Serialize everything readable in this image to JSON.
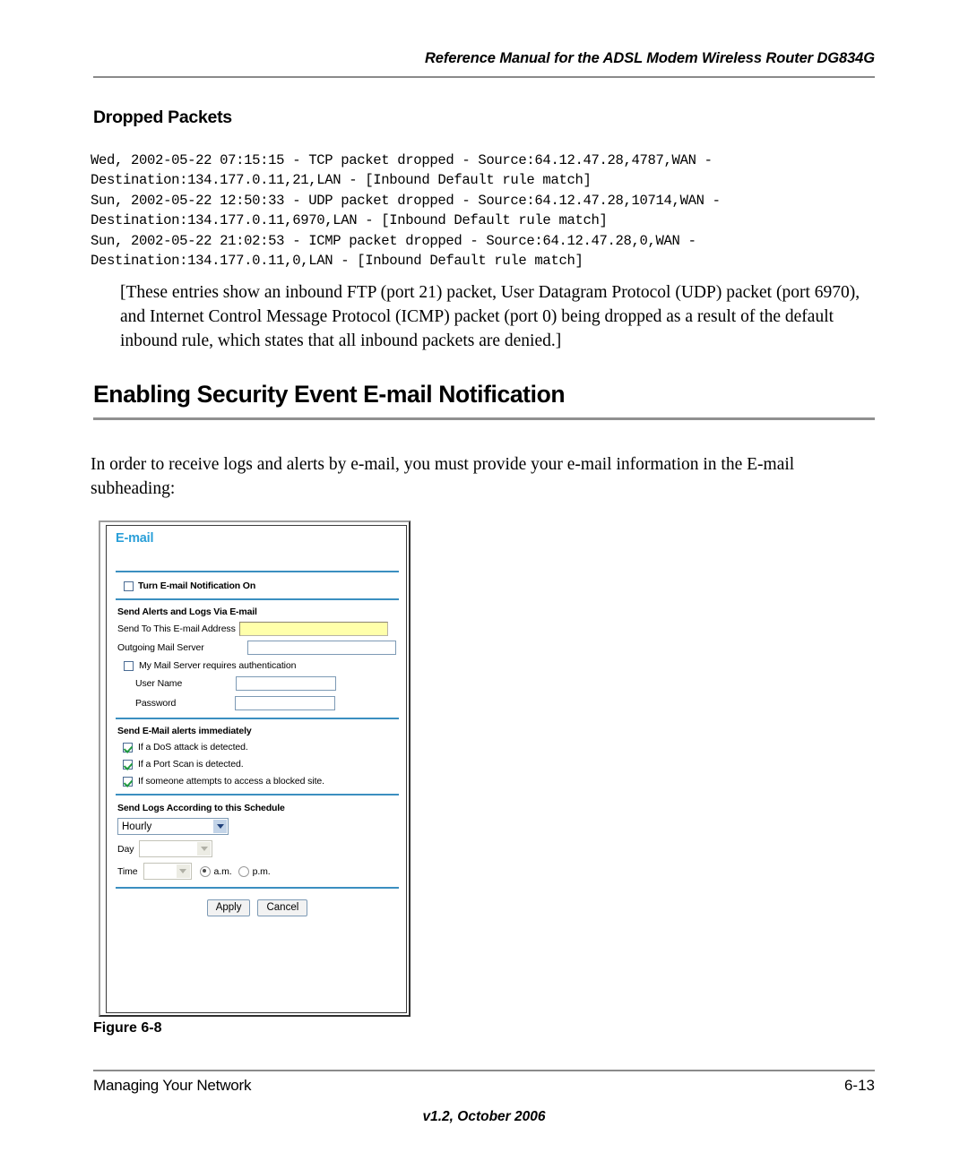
{
  "header": {
    "running_head": "Reference Manual for the ADSL Modem Wireless Router DG834G"
  },
  "sections": {
    "dropped_packets_heading": "Dropped Packets",
    "log_text": "Wed, 2002-05-22 07:15:15 - TCP packet dropped - Source:64.12.47.28,4787,WAN -\nDestination:134.177.0.11,21,LAN - [Inbound Default rule match]\nSun, 2002-05-22 12:50:33 - UDP packet dropped - Source:64.12.47.28,10714,WAN -\nDestination:134.177.0.11,6970,LAN - [Inbound Default rule match]\nSun, 2002-05-22 21:02:53 - ICMP packet dropped - Source:64.12.47.28,0,WAN -\nDestination:134.177.0.11,0,LAN - [Inbound Default rule match]",
    "note_paragraph": "[These entries show an inbound FTP (port 21) packet, User Datagram Protocol (UDP) packet (port 6970), and Internet Control Message Protocol (ICMP) packet (port 0) being dropped as a result of the default inbound rule, which states that all inbound packets are denied.]",
    "main_heading": "Enabling Security Event E-mail Notification",
    "intro_paragraph": "In order to receive logs and alerts by e-mail, you must provide your e-mail information in the E-mail subheading:"
  },
  "figure": {
    "caption": "Figure 6-8",
    "panel_title": "E-mail",
    "notification_checkbox": {
      "label": "Turn E-mail Notification On",
      "checked": false
    },
    "send_alerts_section": {
      "heading": "Send Alerts and Logs Via E-mail",
      "email_address_label": "Send To This E-mail Address",
      "email_address_value": "",
      "mail_server_label": "Outgoing Mail Server",
      "mail_server_value": "",
      "auth_checkbox_label": "My Mail Server requires authentication",
      "auth_checked": false,
      "username_label": "User Name",
      "username_value": "",
      "password_label": "Password",
      "password_value": ""
    },
    "immediate_alerts_section": {
      "heading": "Send E-Mail alerts immediately",
      "items": [
        {
          "label": "If a DoS attack is detected.",
          "checked": true
        },
        {
          "label": "If a Port Scan is detected.",
          "checked": true
        },
        {
          "label": "If someone attempts to access a blocked site.",
          "checked": true
        }
      ]
    },
    "schedule_section": {
      "heading": "Send Logs According to this Schedule",
      "frequency_value": "Hourly",
      "day_label": "Day",
      "day_value": "",
      "time_label": "Time",
      "time_value": "",
      "am_label": "a.m.",
      "pm_label": "p.m.",
      "meridiem_selected": "a.m."
    },
    "buttons": {
      "apply": "Apply",
      "cancel": "Cancel"
    },
    "colors": {
      "panel_title": "#2a9fd8",
      "separator": "#3b8fc0",
      "focused_field": "#ffffaa",
      "check_mark": "#1f9a3f"
    }
  },
  "footer": {
    "left": "Managing Your Network",
    "right": "6-13",
    "center": "v1.2, October 2006"
  }
}
